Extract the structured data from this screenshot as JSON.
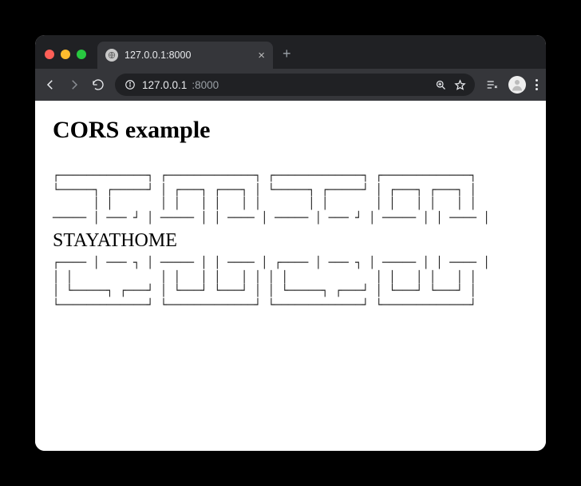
{
  "tab": {
    "title": "127.0.0.1:8000"
  },
  "omnibox": {
    "host": "127.0.0.1",
    "path": ":8000"
  },
  "page": {
    "heading": "CORS example",
    "banner_top": "┌─────────────┐ ┌─────────────┐ ┌─────────────┐ ┌─────────────┐\n└─────┐ ┌─────┘ │ ┌───┐ ┌───┐ │ └─────┐ ┌─────┘ │ ┌───┐ ┌───┐ │\n      │ │       │ │   │ │   │ │       │ │       │ │   │ │   │ │\n───── │ ─── ┘ │ ───── │ │ ──── │ ───── │ ─── ┘ │ ───── │ │ ──── │",
    "center_text": "STAYATHOME",
    "banner_bottom": "┌──── │ ─── ┐ │ ───── │ │ ──── │ ┌──── │ ─── ┐ │ ───── │ │ ──── │\n│ │             │ │   │ │   │ │ │ │             │ │   │ │   │ │\n│ └─────┐ ┌───┘ │ └───┘ └───┘ │ │ └─────┐ ┌───┘ │ └───┘ └───┘ │\n└─────────────┘ └─────────────┘ └─────────────┘ └─────────────┘"
  }
}
